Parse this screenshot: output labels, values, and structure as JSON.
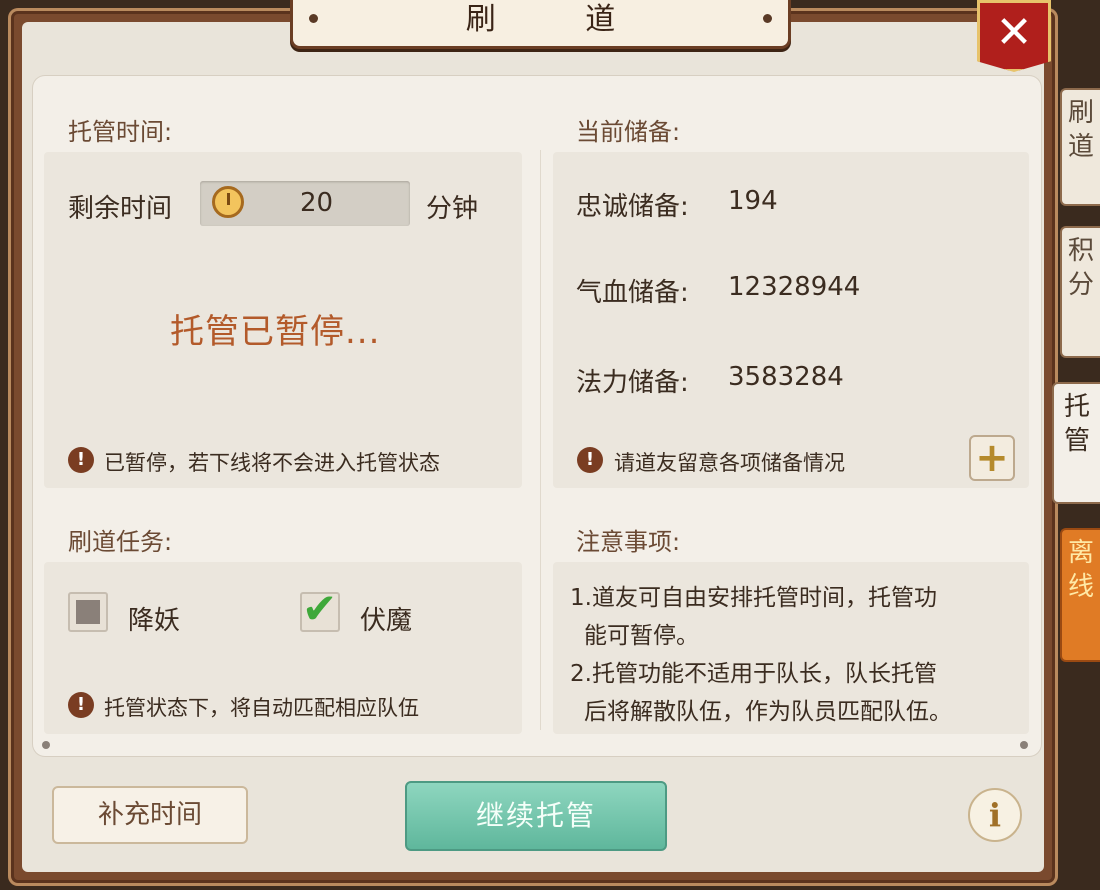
{
  "window": {
    "title": "刷  道",
    "close_label": "✕"
  },
  "side_tabs": [
    {
      "label": "刷道"
    },
    {
      "label": "积分"
    },
    {
      "label": "托管"
    },
    {
      "label": "离线"
    }
  ],
  "hosting_time": {
    "header": "托管时间:",
    "remaining_label": "剩余时间",
    "remaining_value": "20",
    "unit": "分钟",
    "status": "托管已暂停...",
    "warning": "已暂停，若下线将不会进入托管状态"
  },
  "reserves": {
    "header": "当前储备:",
    "items": [
      {
        "label": "忠诚储备:",
        "value": "194"
      },
      {
        "label": "气血储备:",
        "value": "12328944"
      },
      {
        "label": "法力储备:",
        "value": "3583284"
      }
    ],
    "warning": "请道友留意各项储备情况",
    "add_label": "+"
  },
  "tasks": {
    "header": "刷道任务:",
    "options": [
      {
        "label": "降妖",
        "checked": false
      },
      {
        "label": "伏魔",
        "checked": true
      }
    ],
    "warning": "托管状态下，将自动匹配相应队伍"
  },
  "notes": {
    "header": "注意事项:",
    "lines": [
      "1.道友可自由安排托管时间，托管功",
      "能可暂停。",
      "2.托管功能不适用于队长，队长托管",
      "后将解散队伍，作为队员匹配队伍。"
    ]
  },
  "footer": {
    "supplement_label": "补充时间",
    "continue_label": "继续托管",
    "info_label": "i"
  }
}
